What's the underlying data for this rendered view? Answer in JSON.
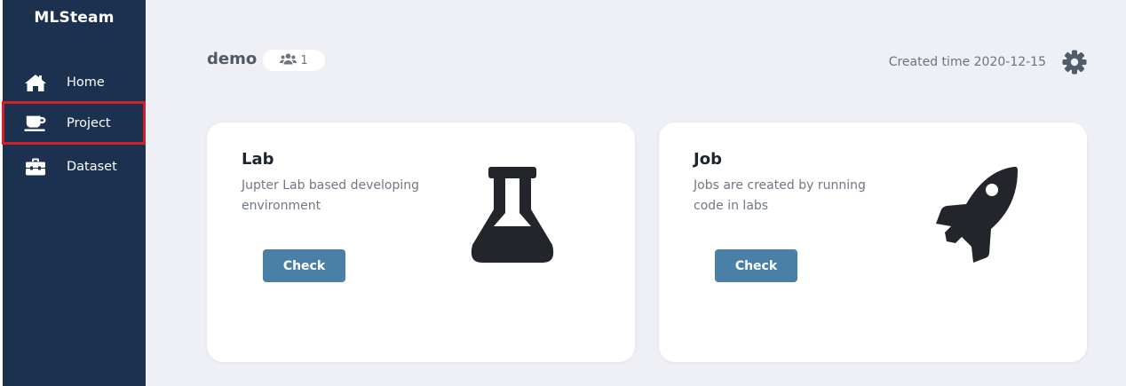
{
  "sidebar": {
    "brand": "MLSteam",
    "items": [
      {
        "label": "Home",
        "icon": "home-icon"
      },
      {
        "label": "Project",
        "icon": "coffee-cup-icon"
      },
      {
        "label": "Dataset",
        "icon": "toolbox-icon"
      }
    ]
  },
  "header": {
    "project_name": "demo",
    "member_count": "1",
    "member_icon": "users-icon",
    "created_time": "Created time 2020-12-15",
    "settings_icon": "gear-icon"
  },
  "cards": [
    {
      "title": "Lab",
      "description": "Jupter Lab based developing environment",
      "button_label": "Check",
      "icon": "flask-icon"
    },
    {
      "title": "Job",
      "description": "Jobs are created by running code in labs",
      "button_label": "Check",
      "icon": "rocket-icon"
    }
  ],
  "colors": {
    "sidebar_bg": "#1c3050",
    "page_bg": "#eef0f6",
    "button_bg": "#4a7fa6",
    "highlight_border": "#d0202a",
    "icon_dark": "#22262b"
  }
}
